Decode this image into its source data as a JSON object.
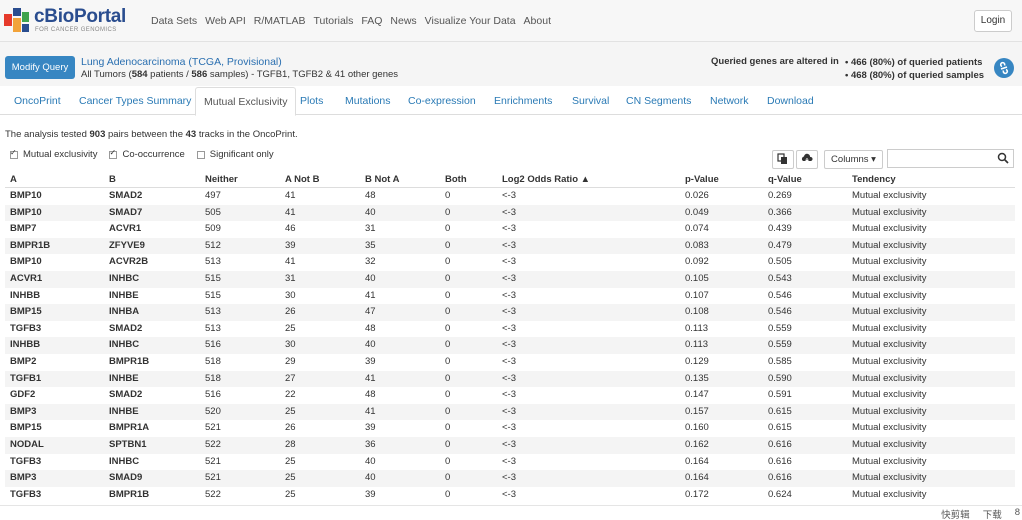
{
  "nav": {
    "logo_text": "cBioPortal",
    "logo_sub": "FOR CANCER GENOMICS",
    "links": [
      "Data Sets",
      "Web API",
      "R/MATLAB",
      "Tutorials",
      "FAQ",
      "News",
      "Visualize Your Data",
      "About"
    ],
    "login": "Login"
  },
  "query": {
    "modify_label": "Modify Query",
    "study_name": "Lung Adenocarcinoma (TCGA, Provisional)",
    "tumors_prefix": "All Tumors (",
    "patients": "584",
    "patients_suffix": " patients / ",
    "samples": "586",
    "samples_suffix": " samples)  - TGFB1, TGFB2 & 41 other genes",
    "altered_label": "Queried genes are altered in",
    "stat_patients": "• 466 (80%) of queried patients",
    "stat_samples": "• 468 (80%) of queried samples"
  },
  "tabs": [
    "OncoPrint",
    "Cancer Types Summary",
    "Mutual Exclusivity",
    "Plots",
    "Mutations",
    "Co-expression",
    "Enrichments",
    "Survival",
    "CN Segments",
    "Network",
    "Download"
  ],
  "active_tab": "Mutual Exclusivity",
  "analysis": {
    "p1": "The analysis tested ",
    "pairs": "903",
    "p2": " pairs between the ",
    "tracks": "43",
    "p3": " tracks in the OncoPrint."
  },
  "filters": [
    {
      "label": "Mutual exclusivity",
      "checked": true
    },
    {
      "label": "Co-occurrence",
      "checked": true
    },
    {
      "label": "Significant only",
      "checked": false
    }
  ],
  "toolbar": {
    "copy_icon": "copy-icon",
    "download_icon": "cloud-download-icon",
    "columns_label": "Columns ▾",
    "search_placeholder": ""
  },
  "table": {
    "headers": [
      "A",
      "B",
      "Neither",
      "A Not B",
      "B Not A",
      "Both",
      "Log2 Odds Ratio ▲",
      "p-Value",
      "q-Value",
      "Tendency"
    ],
    "rows": [
      [
        "BMP10",
        "SMAD2",
        "497",
        "41",
        "48",
        "0",
        "<-3",
        "0.026",
        "0.269",
        "Mutual exclusivity"
      ],
      [
        "BMP10",
        "SMAD7",
        "505",
        "41",
        "40",
        "0",
        "<-3",
        "0.049",
        "0.366",
        "Mutual exclusivity"
      ],
      [
        "BMP7",
        "ACVR1",
        "509",
        "46",
        "31",
        "0",
        "<-3",
        "0.074",
        "0.439",
        "Mutual exclusivity"
      ],
      [
        "BMPR1B",
        "ZFYVE9",
        "512",
        "39",
        "35",
        "0",
        "<-3",
        "0.083",
        "0.479",
        "Mutual exclusivity"
      ],
      [
        "BMP10",
        "ACVR2B",
        "513",
        "41",
        "32",
        "0",
        "<-3",
        "0.092",
        "0.505",
        "Mutual exclusivity"
      ],
      [
        "ACVR1",
        "INHBC",
        "515",
        "31",
        "40",
        "0",
        "<-3",
        "0.105",
        "0.543",
        "Mutual exclusivity"
      ],
      [
        "INHBB",
        "INHBE",
        "515",
        "30",
        "41",
        "0",
        "<-3",
        "0.107",
        "0.546",
        "Mutual exclusivity"
      ],
      [
        "BMP15",
        "INHBA",
        "513",
        "26",
        "47",
        "0",
        "<-3",
        "0.108",
        "0.546",
        "Mutual exclusivity"
      ],
      [
        "TGFB3",
        "SMAD2",
        "513",
        "25",
        "48",
        "0",
        "<-3",
        "0.113",
        "0.559",
        "Mutual exclusivity"
      ],
      [
        "INHBB",
        "INHBC",
        "516",
        "30",
        "40",
        "0",
        "<-3",
        "0.113",
        "0.559",
        "Mutual exclusivity"
      ],
      [
        "BMP2",
        "BMPR1B",
        "518",
        "29",
        "39",
        "0",
        "<-3",
        "0.129",
        "0.585",
        "Mutual exclusivity"
      ],
      [
        "TGFB1",
        "INHBE",
        "518",
        "27",
        "41",
        "0",
        "<-3",
        "0.135",
        "0.590",
        "Mutual exclusivity"
      ],
      [
        "GDF2",
        "SMAD2",
        "516",
        "22",
        "48",
        "0",
        "<-3",
        "0.147",
        "0.591",
        "Mutual exclusivity"
      ],
      [
        "BMP3",
        "INHBE",
        "520",
        "25",
        "41",
        "0",
        "<-3",
        "0.157",
        "0.615",
        "Mutual exclusivity"
      ],
      [
        "BMP15",
        "BMPR1A",
        "521",
        "26",
        "39",
        "0",
        "<-3",
        "0.160",
        "0.615",
        "Mutual exclusivity"
      ],
      [
        "NODAL",
        "SPTBN1",
        "522",
        "28",
        "36",
        "0",
        "<-3",
        "0.162",
        "0.616",
        "Mutual exclusivity"
      ],
      [
        "TGFB3",
        "INHBC",
        "521",
        "25",
        "40",
        "0",
        "<-3",
        "0.164",
        "0.616",
        "Mutual exclusivity"
      ],
      [
        "BMP3",
        "SMAD9",
        "521",
        "25",
        "40",
        "0",
        "<-3",
        "0.164",
        "0.616",
        "Mutual exclusivity"
      ],
      [
        "TGFB3",
        "BMPR1B",
        "522",
        "25",
        "39",
        "0",
        "<-3",
        "0.172",
        "0.624",
        "Mutual exclusivity"
      ]
    ]
  },
  "bottombar": {
    "items": [
      "快剪辑",
      "下载",
      "8"
    ]
  },
  "colors": {
    "primary": "#3786c2",
    "link": "#2a7ab5",
    "logo": "#2a4d8f"
  }
}
